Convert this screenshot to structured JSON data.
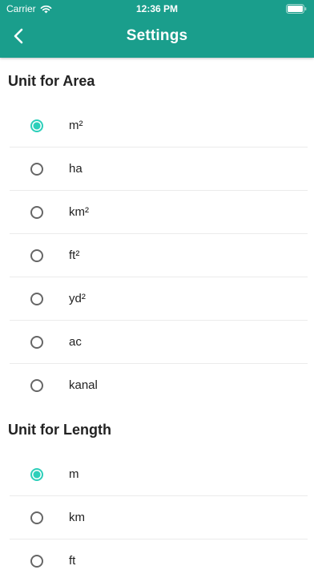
{
  "status_bar": {
    "carrier": "Carrier",
    "time": "12:36 PM"
  },
  "header": {
    "title": "Settings",
    "back_icon": "chevron-left-icon"
  },
  "colors": {
    "header_bg": "#1a9e8c",
    "radio_selected": "#2dcfba"
  },
  "area_section": {
    "title": "Unit for Area",
    "selected": "m²",
    "options": [
      "m²",
      "ha",
      "km²",
      "ft²",
      "yd²",
      "ac",
      "kanal"
    ]
  },
  "length_section": {
    "title": "Unit for Length",
    "selected": "m",
    "options": [
      "m",
      "km",
      "ft"
    ]
  }
}
